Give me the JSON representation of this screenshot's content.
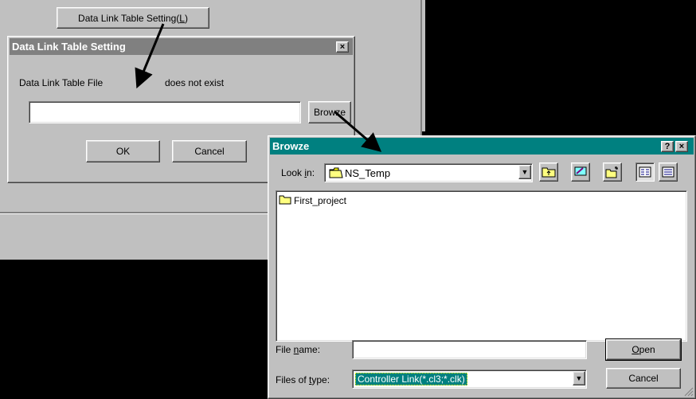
{
  "background_window": {
    "data_link_button_label": "Data Link Table Setting(",
    "data_link_button_key": "L",
    "data_link_button_suffix": ")"
  },
  "setting_dialog": {
    "title": "Data Link Table Setting",
    "file_label": "Data Link Table File",
    "not_exist_text": "does not exist",
    "path_value": "",
    "browse_label": "Browze",
    "ok_label": "OK",
    "cancel_label": "Cancel",
    "close_glyph": "×"
  },
  "browse_dialog": {
    "title": "Browze",
    "help_glyph": "?",
    "close_glyph": "×",
    "look_in_label_pre": "Look ",
    "look_in_label_key": "i",
    "look_in_label_post": "n:",
    "look_in_value": "NS_Temp",
    "toolbar_icons": [
      "up-folder-icon",
      "desktop-icon",
      "new-folder-icon",
      "list-view-icon",
      "details-view-icon"
    ],
    "items": [
      {
        "name": "First_project",
        "icon": "folder-icon"
      }
    ],
    "file_name_label_pre": "File ",
    "file_name_label_key": "n",
    "file_name_label_post": "ame:",
    "file_name_value": "",
    "files_of_type_label_pre": "Files of ",
    "files_of_type_label_key": "t",
    "files_of_type_label_post": "ype:",
    "files_of_type_value": "Controller Link(*.cl3;*.clk)",
    "open_label_key": "O",
    "open_label_post": "pen",
    "cancel_label": "Cancel"
  },
  "colors": {
    "window_gray": "#c0c0c0",
    "title_teal": "#008080",
    "title_inactive": "#808080",
    "selection_navy": "#000080",
    "screen_black": "#000000"
  }
}
